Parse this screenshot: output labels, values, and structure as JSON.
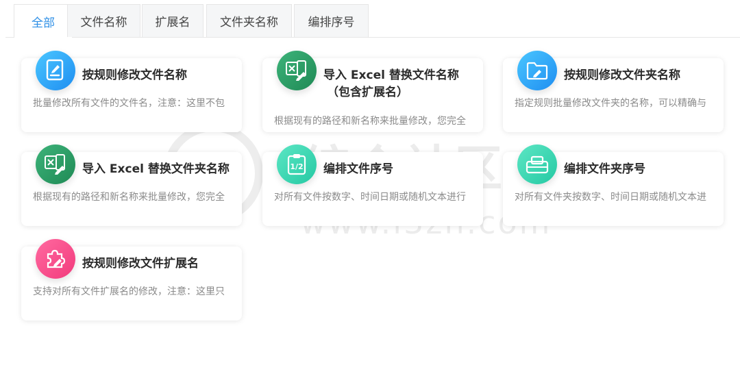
{
  "tabs": [
    {
      "label": "全部",
      "active": true
    },
    {
      "label": "文件名称",
      "active": false
    },
    {
      "label": "扩展名",
      "active": false
    },
    {
      "label": "文件夹名称",
      "active": false
    },
    {
      "label": "编排序号",
      "active": false
    }
  ],
  "cards": [
    {
      "title": "按规则修改文件名称",
      "subtitle": "",
      "description": "批量修改所有文件的文件名，注意：这里不包",
      "icon": "file-edit-icon",
      "color": "#1f8ef1"
    },
    {
      "title": "导入 Excel 替换文件名称",
      "subtitle": "（包含扩展名）",
      "description": "根据现有的路径和新名称来批量修改，您完全",
      "icon": "excel-edit-icon",
      "color": "#1f8a55"
    },
    {
      "title": "按规则修改文件夹名称",
      "subtitle": "",
      "description": "指定规则批量修改文件夹的名称，可以精确与",
      "icon": "folder-edit-icon",
      "color": "#1f8ef1"
    },
    {
      "title": "导入 Excel 替换文件夹名称",
      "subtitle": "",
      "description": "根据现有的路径和新名称来批量修改，您完全",
      "icon": "excel-edit-icon",
      "color": "#1f8a55"
    },
    {
      "title": "编排文件序号",
      "subtitle": "",
      "description": "对所有文件按数字、时间日期或随机文本进行",
      "icon": "clipboard-number-icon",
      "color": "#25c9a3"
    },
    {
      "title": "编排文件夹序号",
      "subtitle": "",
      "description": "对所有文件夹按数字、时间日期或随机文本进",
      "icon": "folder-number-icon",
      "color": "#25c9a3"
    },
    {
      "title": "按规则修改文件扩展名",
      "subtitle": "",
      "description": "支持对所有文件扩展名的修改，注意：这里只",
      "icon": "puzzle-edit-icon",
      "color": "#f23a7c"
    }
  ],
  "watermark": {
    "text": "i综合社区",
    "url": "www.i3zh.com"
  }
}
